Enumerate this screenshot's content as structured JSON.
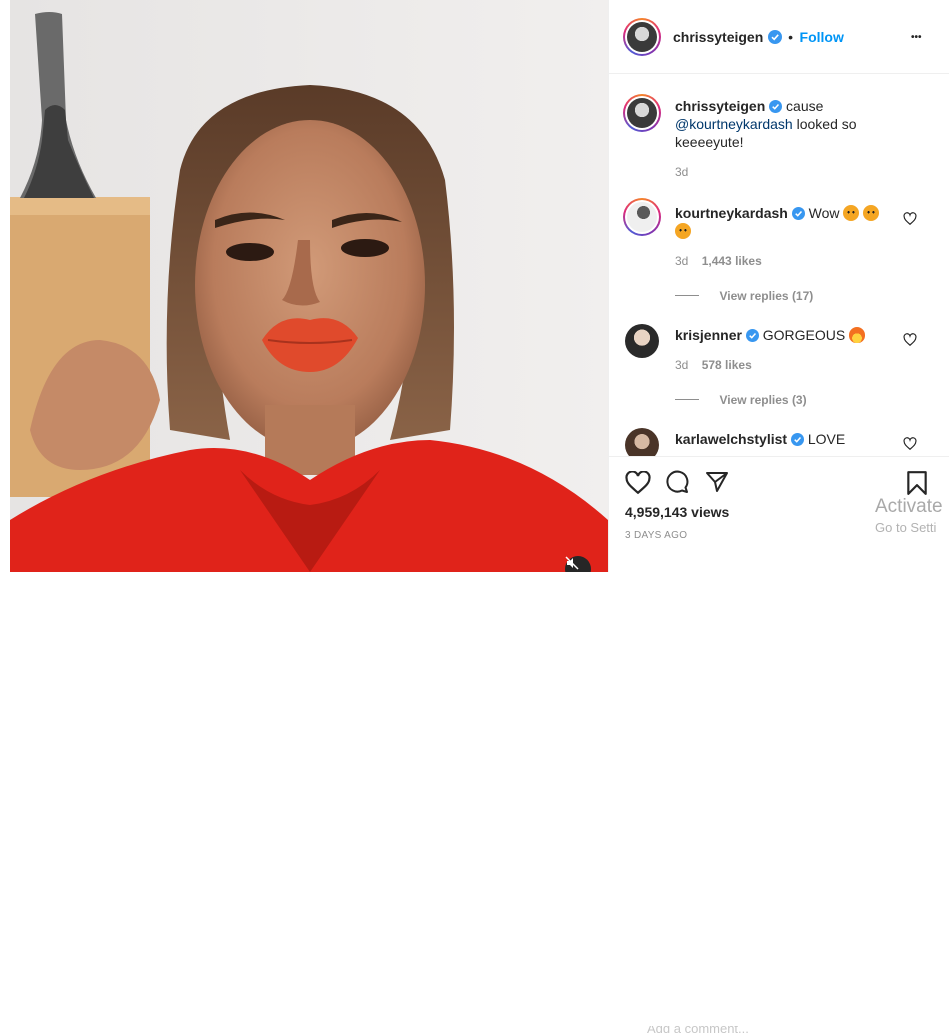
{
  "post": {
    "author": "chrissyteigen",
    "follow_label": "Follow",
    "dot": "•",
    "more": "•••"
  },
  "caption": {
    "author": "chrissyteigen",
    "text_before": "cause",
    "mention": "@kourtneykardash",
    "text_after": "looked so keeeeyute!",
    "time": "3d"
  },
  "comments": [
    {
      "author": "kourtneykardash",
      "text": "Wow",
      "emojis": [
        "tiger-face",
        "tiger-face",
        "tiger-face"
      ],
      "time": "3d",
      "likes": "1,443 likes",
      "replies": "View replies (17)",
      "verified": true
    },
    {
      "author": "krisjenner",
      "text": "GORGEOUS",
      "emojis": [
        "fire"
      ],
      "time": "3d",
      "likes": "578 likes",
      "replies": "View replies (3)",
      "verified": true
    },
    {
      "author": "karlawelchstylist",
      "text": "LOVE",
      "verified": true
    }
  ],
  "actions": {
    "views": "4,959,143 views",
    "date": "3 DAYS AGO",
    "comment_placeholder": "Add a comment..."
  },
  "os_overlay": {
    "title": "Activate",
    "subtitle": "Go to Setti"
  },
  "colors": {
    "link_blue": "#0095f6",
    "mention": "#00376b",
    "muted": "#8e8e8e",
    "verified": "#3897f0"
  }
}
